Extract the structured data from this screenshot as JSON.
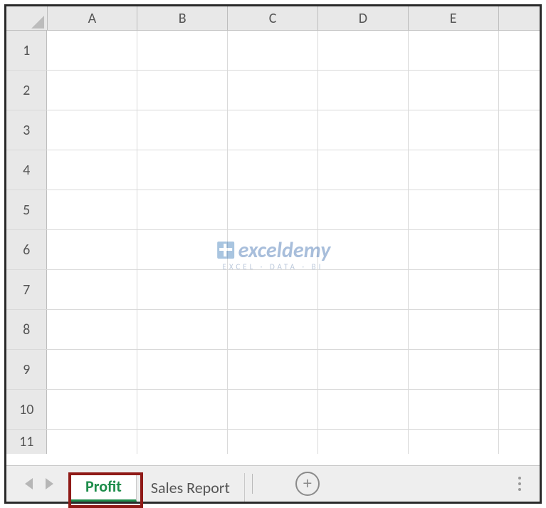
{
  "columns": [
    "A",
    "B",
    "C",
    "D",
    "E"
  ],
  "rows": [
    "1",
    "2",
    "3",
    "4",
    "5",
    "6",
    "7",
    "8",
    "9",
    "10",
    "11"
  ],
  "tabs": {
    "active": "Profit",
    "others": [
      "Sales Report"
    ]
  },
  "nav": {
    "prev_enabled": false,
    "next_enabled": false
  },
  "new_sheet_label": "+",
  "watermark": {
    "brand_main": "exceldemy",
    "tagline": "EXCEL · DATA · BI"
  }
}
